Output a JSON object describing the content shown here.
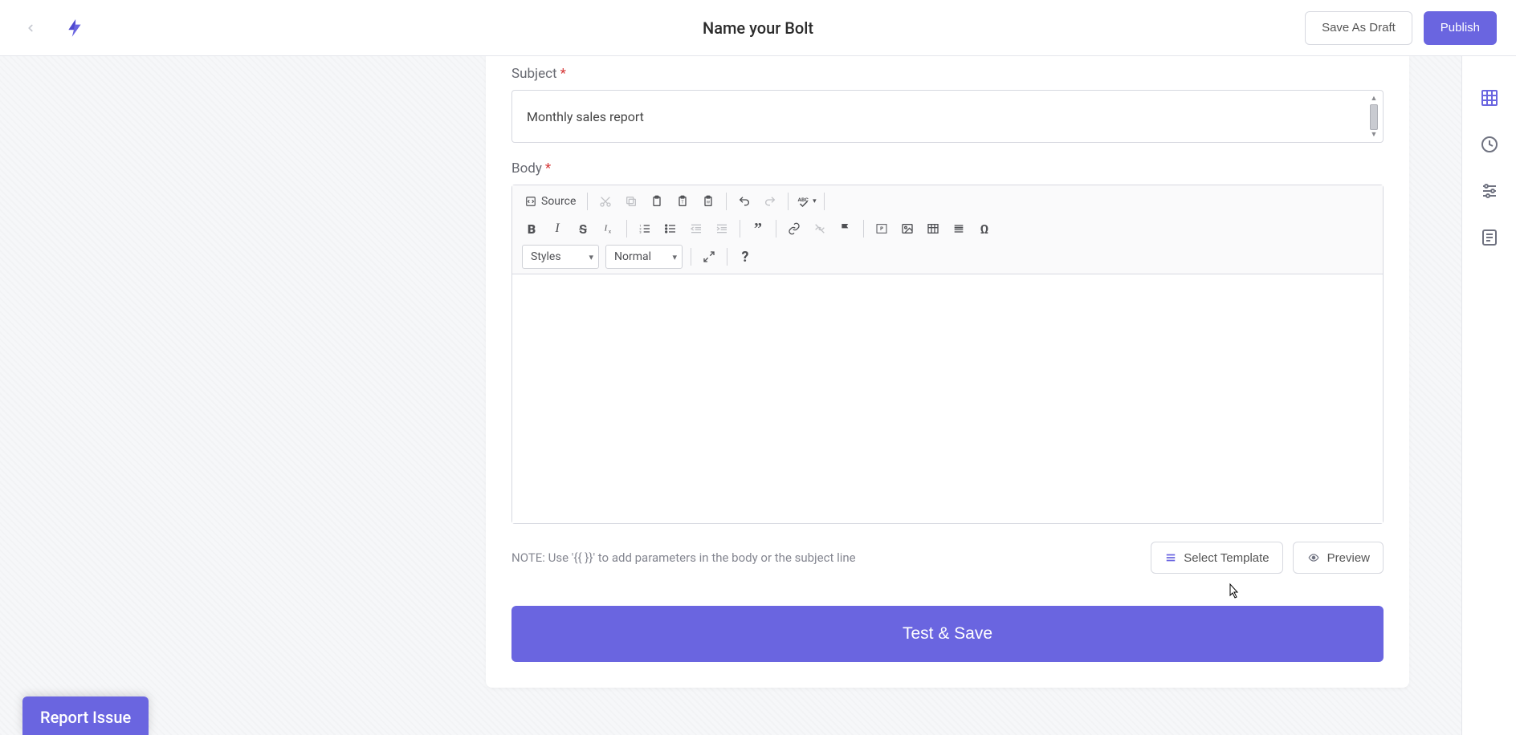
{
  "header": {
    "title": "Name your Bolt",
    "save_draft": "Save As Draft",
    "publish": "Publish"
  },
  "form": {
    "subject_label": "Subject",
    "subject_value": "Monthly sales report",
    "body_label": "Body",
    "editor": {
      "source": "Source",
      "styles": "Styles",
      "format": "Normal"
    },
    "note": "NOTE: Use '{{ }}' to add parameters in the body or the subject line",
    "select_template": "Select Template",
    "preview": "Preview",
    "submit": "Test & Save"
  },
  "footer": {
    "report_issue": "Report Issue"
  },
  "colors": {
    "accent": "#6a65e0"
  }
}
